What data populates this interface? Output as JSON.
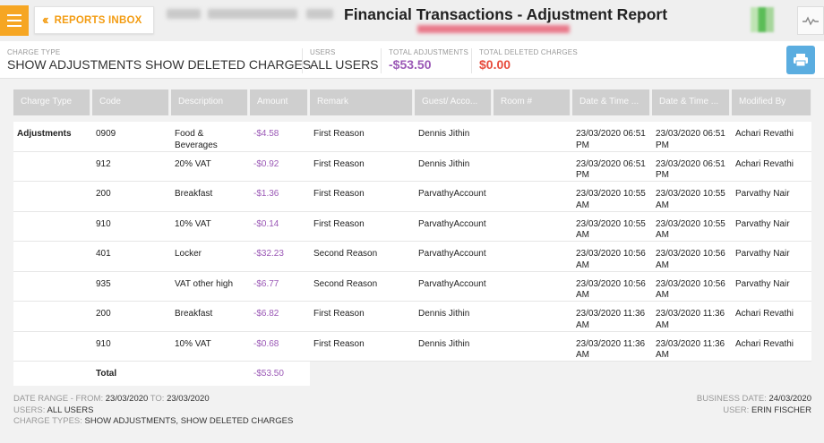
{
  "header": {
    "inbox_label": "REPORTS INBOX",
    "title": "Financial Transactions - Adjustment Report"
  },
  "summary": {
    "charge_type_label": "CHARGE TYPE",
    "charge_type_value": "SHOW ADJUSTMENTS SHOW DELETED CHARGES",
    "users_label": "USERS",
    "users_value": "ALL USERS",
    "total_adj_label": "TOTAL ADJUSTMENTS",
    "total_adj_value": "-$53.50",
    "total_del_label": "TOTAL DELETED CHARGES",
    "total_del_value": "$0.00"
  },
  "table": {
    "columns": [
      "Charge Type",
      "Code",
      "Description",
      "Amount",
      "Remark",
      "Guest/ Acco...",
      "Room #",
      "Date & Time ...",
      "Date & Time ...",
      "Modified By"
    ],
    "group_label": "Adjustments",
    "rows": [
      {
        "code": "0909",
        "desc": "Food & Beverages",
        "amount": "-$4.58",
        "remark": "First Reason",
        "guest": "Dennis Jithin",
        "room": "",
        "dt1": "23/03/2020 06:51 PM",
        "dt2": "23/03/2020 06:51 PM",
        "by": "Achari Revathi"
      },
      {
        "code": "912",
        "desc": "20% VAT",
        "amount": "-$0.92",
        "remark": "First Reason",
        "guest": "Dennis Jithin",
        "room": "",
        "dt1": "23/03/2020 06:51 PM",
        "dt2": "23/03/2020 06:51 PM",
        "by": "Achari Revathi"
      },
      {
        "code": "200",
        "desc": "Breakfast",
        "amount": "-$1.36",
        "remark": "First Reason",
        "guest": "ParvathyAccount",
        "room": "",
        "dt1": "23/03/2020 10:55 AM",
        "dt2": "23/03/2020 10:55 AM",
        "by": "Parvathy Nair"
      },
      {
        "code": "910",
        "desc": "10% VAT",
        "amount": "-$0.14",
        "remark": "First Reason",
        "guest": "ParvathyAccount",
        "room": "",
        "dt1": "23/03/2020 10:55 AM",
        "dt2": "23/03/2020 10:55 AM",
        "by": "Parvathy Nair"
      },
      {
        "code": "401",
        "desc": "Locker",
        "amount": "-$32.23",
        "remark": "Second Reason",
        "guest": "ParvathyAccount",
        "room": "",
        "dt1": "23/03/2020 10:56 AM",
        "dt2": "23/03/2020 10:56 AM",
        "by": "Parvathy Nair"
      },
      {
        "code": "935",
        "desc": "VAT other high",
        "amount": "-$6.77",
        "remark": "Second Reason",
        "guest": "ParvathyAccount",
        "room": "",
        "dt1": "23/03/2020 10:56 AM",
        "dt2": "23/03/2020 10:56 AM",
        "by": "Parvathy Nair"
      },
      {
        "code": "200",
        "desc": "Breakfast",
        "amount": "-$6.82",
        "remark": "First Reason",
        "guest": "Dennis Jithin",
        "room": "",
        "dt1": "23/03/2020 11:36 AM",
        "dt2": "23/03/2020 11:36 AM",
        "by": "Achari Revathi"
      },
      {
        "code": "910",
        "desc": "10% VAT",
        "amount": "-$0.68",
        "remark": "First Reason",
        "guest": "Dennis Jithin",
        "room": "",
        "dt1": "23/03/2020 11:36 AM",
        "dt2": "23/03/2020 11:36 AM",
        "by": "Achari Revathi"
      }
    ],
    "total_label": "Total",
    "total_value": "-$53.50"
  },
  "footer": {
    "date_range_label": "DATE RANGE - FROM: ",
    "date_from": "23/03/2020",
    "to_label": " TO: ",
    "date_to": "23/03/2020",
    "users_label": "USERS: ",
    "users_value": "ALL USERS",
    "charge_types_label": "CHARGE TYPES: ",
    "charge_types_value": "SHOW ADJUSTMENTS, SHOW DELETED CHARGES",
    "business_date_label": "BUSINESS DATE: ",
    "business_date_value": "24/03/2020",
    "user_label": "USER: ",
    "user_value": "ERIN FISCHER"
  },
  "colors": {
    "accent": "#f6a623",
    "amount": "#9b59b6",
    "deleted": "#e74c3c",
    "print": "#5aade0"
  },
  "icons": [
    "menu-icon",
    "double-chevron-left-icon",
    "pulse-icon",
    "print-icon"
  ]
}
